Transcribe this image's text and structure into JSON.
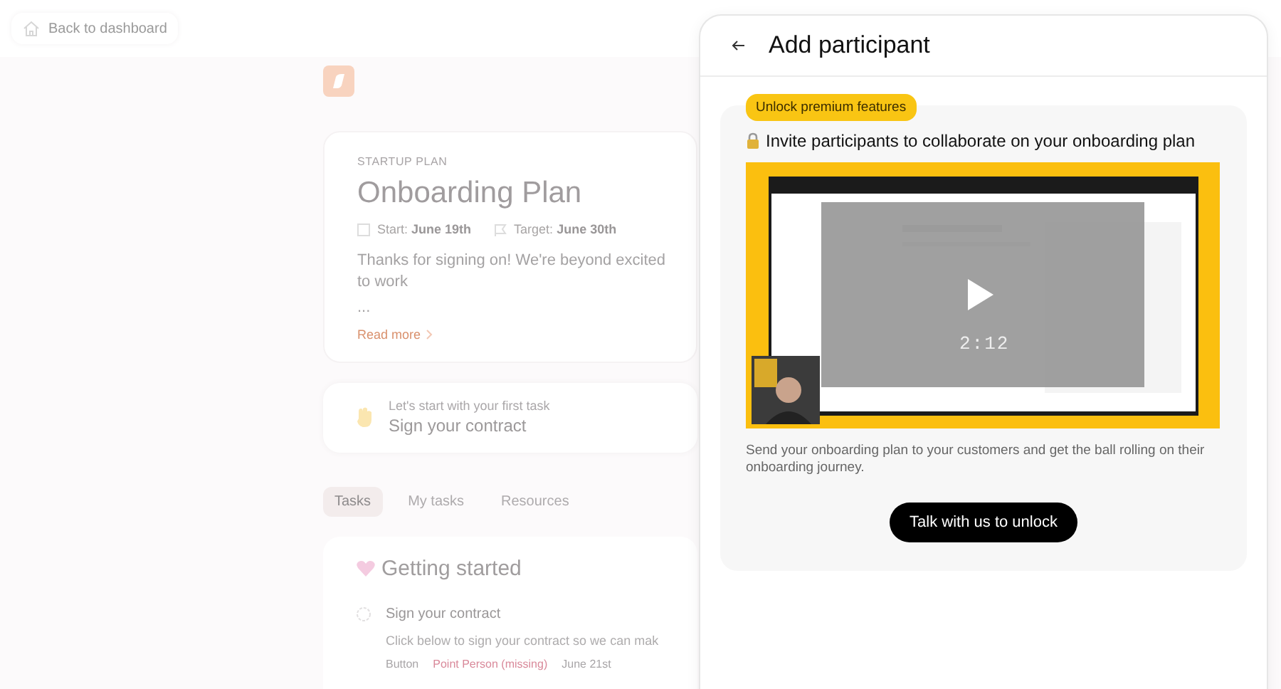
{
  "back_link": "Back to dashboard",
  "plan": {
    "eyebrow": "STARTUP PLAN",
    "title": "Onboarding Plan",
    "start_label": "Start:",
    "start_date": "June 19th",
    "target_label": "Target:",
    "target_date": "June 30th",
    "description": "Thanks for signing on! We're beyond excited to work",
    "ellipsis": "...",
    "read_more": "Read more"
  },
  "first_task": {
    "hint": "Let's start with your first task",
    "title": "Sign your contract"
  },
  "tabs": [
    {
      "label": "Tasks",
      "selected": true
    },
    {
      "label": "My tasks",
      "selected": false
    },
    {
      "label": "Resources",
      "selected": false
    }
  ],
  "section": {
    "title": "Getting started",
    "tasks": [
      {
        "title": "Sign your contract",
        "description": "Click below to sign your contract so we can mak",
        "type": "Button",
        "assignee": "Point Person (missing)",
        "due": "June 21st"
      }
    ]
  },
  "panel": {
    "title": "Add participant",
    "badge": "Unlock premium features",
    "heading": "Invite participants to collaborate on your onboarding plan",
    "video": {
      "duration": "2:12"
    },
    "description": "Send your onboarding plan to your customers and get the ball rolling on their onboarding journey.",
    "button": "Talk with us to unlock"
  }
}
